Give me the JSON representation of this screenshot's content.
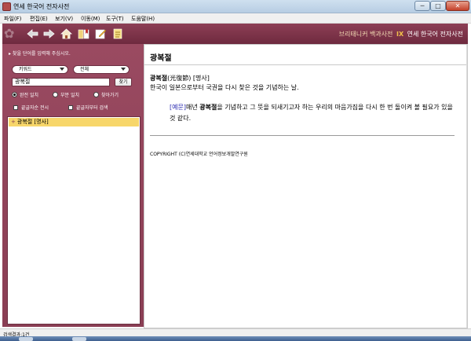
{
  "window": {
    "title": "연세 한국어 전자사전",
    "min_glyph": "─",
    "max_glyph": "□",
    "close_glyph": "✕"
  },
  "menu": [
    {
      "label": "파일(F)"
    },
    {
      "label": "편집(E)"
    },
    {
      "label": "보기(V)"
    },
    {
      "label": "이동(M)"
    },
    {
      "label": "도구(T)"
    },
    {
      "label": "도움말(H)"
    }
  ],
  "toolbar": {
    "icons": [
      "back-arrow-icon",
      "forward-arrow-icon",
      "home-icon",
      "bookmark-icon",
      "edit-icon",
      "memo-icon"
    ],
    "brand": {
      "subtitle": "브리태니커 백과사전",
      "ix": "IX",
      "title": "연세 한국어 전자사전"
    }
  },
  "search": {
    "hint": "▸ 찾을 단어를 입력해 주십시오.",
    "type_select": "키워드",
    "scope_select": "전체",
    "query": "광복절",
    "find_label": "찾기",
    "radios": [
      {
        "label": "완전 일치",
        "checked": true
      },
      {
        "label": "부분 일치",
        "checked": false
      },
      {
        "label": "찾아가기",
        "checked": false
      }
    ],
    "checks": [
      {
        "label": "끝글자순 전시",
        "checked": false
      },
      {
        "label": "끝글자부터 검색",
        "checked": false
      }
    ]
  },
  "results": [
    {
      "plus": "+",
      "label": "광복절 [명사]"
    }
  ],
  "entry": {
    "headword": "광복절",
    "word_bold": "광복절",
    "hanja": "(光復節)",
    "pos": "[명사]",
    "definition": "한국이 일본으로부터 국권을 다시 찾은 것을 기념하는 날.",
    "example_tag": "[예문]",
    "example_pre": "매년 ",
    "example_bold": "광복절",
    "example_post": "을 기념하고 그 뜻을 되새기고자 하는 우리의 마음가짐을 다시 한 번 돌이켜 볼 필요가 있을 것 같다.",
    "copyright": "COPYRIGHT (C)연세대학교 언어정보개발연구원"
  },
  "status": {
    "text": "검색결과:1건"
  },
  "colors": {
    "accent": "#8a3e54",
    "highlight": "#f7d66a",
    "example_tag": "#2a2ab0"
  }
}
